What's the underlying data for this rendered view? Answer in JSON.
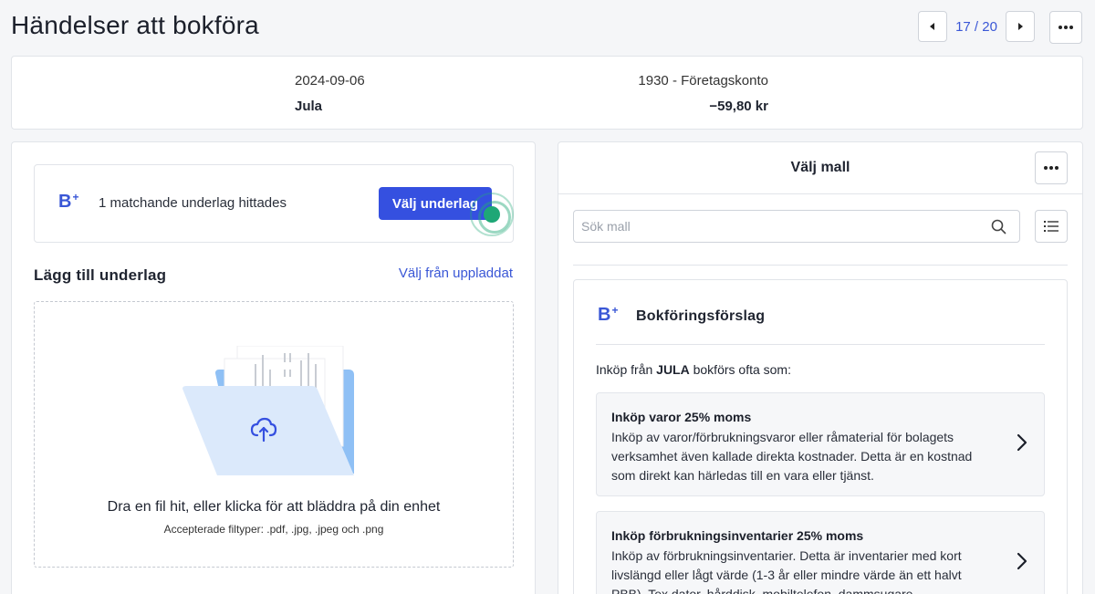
{
  "header": {
    "title": "Händelser att bokföra",
    "pager_text": "17 / 20"
  },
  "transaction": {
    "date": "2024-09-06",
    "merchant": "Jula",
    "account": "1930 - Företagskonto",
    "amount": "−59,80 kr"
  },
  "left": {
    "logo_letter": "B",
    "logo_plus": "+",
    "match_text": "1 matchande underlag hittades",
    "choose_button": "Välj underlag",
    "add_title": "Lägg till underlag",
    "from_uploaded_link": "Välj från uppladdat",
    "drop_text": "Dra en fil hit, eller klicka för att bläddra på din enhet",
    "drop_subtext": "Accepterade filtyper: .pdf, .jpg, .jpeg och .png"
  },
  "right": {
    "title": "Välj mall",
    "search_placeholder": "Sök mall",
    "suggest_title": "Bokföringsförslag",
    "intro_before": "Inköp från ",
    "intro_merchant": "JULA",
    "intro_after": " bokförs ofta som:",
    "options": [
      {
        "title": "Inköp varor 25% moms",
        "desc": "Inköp av varor/förbrukningsvaror eller råmaterial för bolagets verksamhet även kallade direkta kostnader. Detta är en kostnad som direkt kan härledas till en vara eller tjänst."
      },
      {
        "title": "Inköp förbrukningsinventarier 25% moms",
        "desc": "Inköp av förbrukningsinventarier. Detta är inventarier med kort livslängd eller lågt värde (1-3 år eller mindre värde än ett halvt PBB). Tex dator, hårddisk, mobiltelefon, dammsugare"
      }
    ]
  },
  "colors": {
    "accent": "#3550e0",
    "link": "#3a57d6",
    "cursor_green": "#1ea776"
  }
}
